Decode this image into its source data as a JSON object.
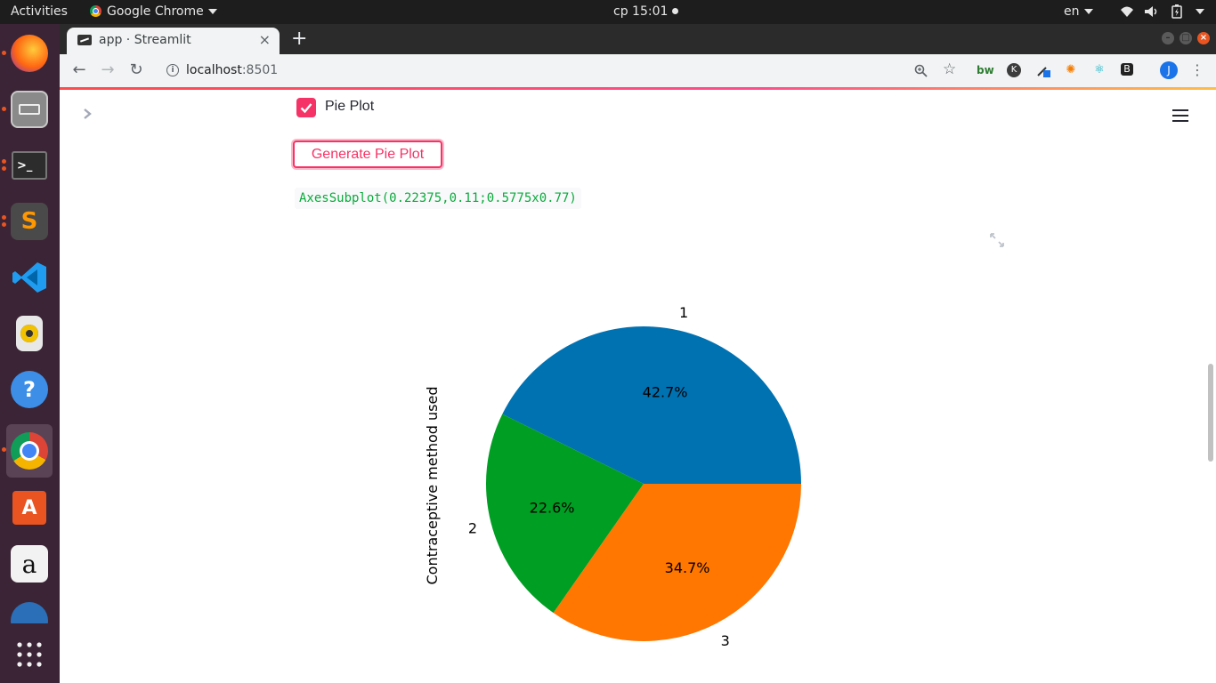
{
  "system_bar": {
    "activities": "Activities",
    "app_menu": "Google Chrome",
    "clock": "cp 15:01",
    "keyboard_layout": "en"
  },
  "dock": {
    "items": [
      "firefox-icon",
      "files-icon",
      "terminal-icon",
      "sublime-text-icon",
      "vscode-icon",
      "rhythmbox-icon",
      "help-icon",
      "chrome-icon",
      "software-center-icon",
      "amazon-icon",
      "thunderbird-icon",
      "show-apps-icon"
    ]
  },
  "browser": {
    "tab_title": "app · Streamlit",
    "url_host": "localhost",
    "url_port": ":8501",
    "profile_initial": "J",
    "extension_bw": "bw",
    "extension_k": "K"
  },
  "app": {
    "checkbox_label": "Pie Plot",
    "checkbox_checked": true,
    "button_label": "Generate Pie Plot",
    "code_output": "AxesSubplot(0.22375,0.11;0.5775x0.77)"
  },
  "chart_data": {
    "type": "pie",
    "ylabel": "Contraceptive method used",
    "categories": [
      "1",
      "2",
      "3"
    ],
    "values": [
      42.7,
      22.6,
      34.7
    ],
    "data_labels": [
      "42.7%",
      "22.6%",
      "34.7%"
    ],
    "colors": [
      "#0072b2",
      "#009e23",
      "#ff7600"
    ],
    "start_angle_deg": 0,
    "direction": "counterclockwise"
  },
  "colors": {
    "accent": "#f63366",
    "code_text": "#09ab3b"
  }
}
